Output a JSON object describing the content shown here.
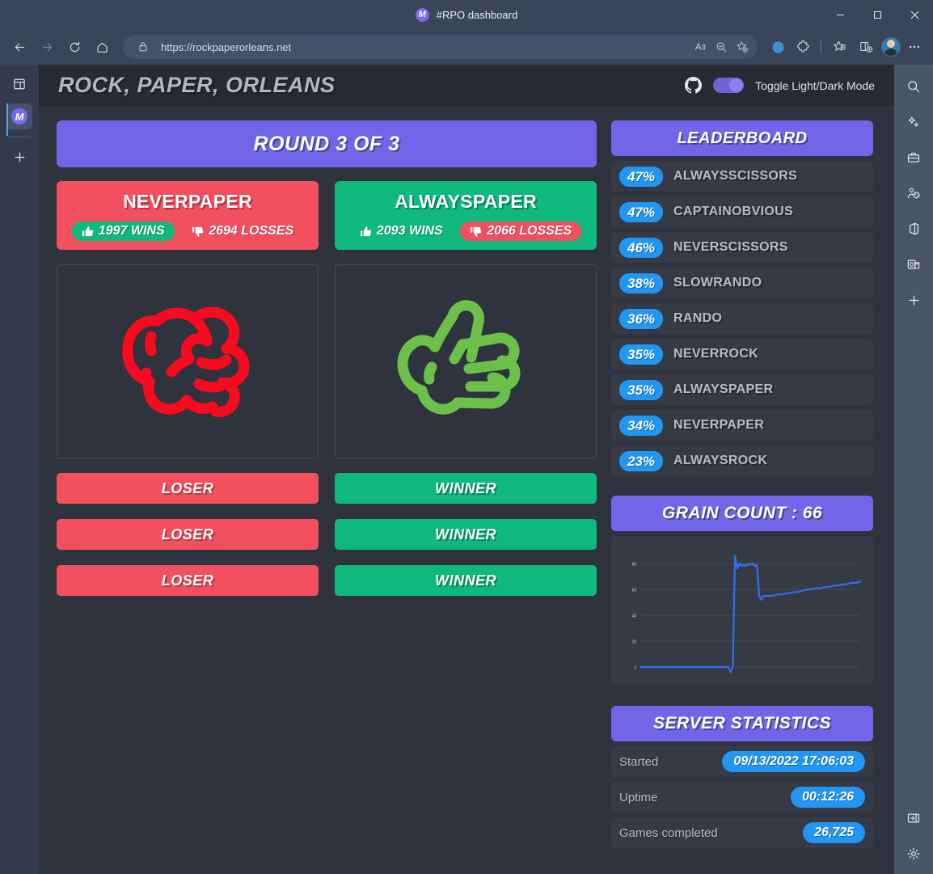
{
  "browser": {
    "tab_title": "#RPO dashboard",
    "tab_favicon": "rpo-logo-icon",
    "url": "https://rockpaperorleans.net",
    "window_controls": [
      "minimize-button",
      "maximize-button",
      "close-button"
    ],
    "nav_icons": [
      "back-icon",
      "forward-icon",
      "refresh-icon",
      "home-icon"
    ],
    "url_icons": [
      "site-permissions-icon",
      "read-aloud-icon",
      "zoom-out-icon",
      "add-favorite-icon"
    ],
    "toolbar_icons": [
      "browser-essentials-icon",
      "extensions-icon",
      "favorites-icon",
      "split-screen-icon",
      "profile-avatar",
      "settings-more-icon"
    ],
    "left_rail_icons": [
      "tab-actions-icon",
      "rpo-tab-icon",
      "new-tab-icon"
    ],
    "right_rail_icons": [
      "search-icon",
      "copilot-icon",
      "tools-icon",
      "games-icon",
      "office-icon",
      "outlook-icon",
      "add-sidebar-icon",
      "expand-sidebar-icon",
      "sidebar-settings-icon"
    ]
  },
  "site": {
    "title": "ROCK, PAPER, ORLEANS",
    "github_label": "github-icon",
    "toggle_label": "Toggle Light/Dark Mode",
    "toggle_on": true,
    "colors": {
      "purple": "#7067e8",
      "red": "#f2505f",
      "green": "#0fb87c",
      "blue": "#2196f3",
      "page_bg": "#2f333d",
      "card_bg": "#353a45"
    }
  },
  "round": {
    "banner": "ROUND 3 OF 3"
  },
  "players": [
    {
      "name": "NEVERPAPER",
      "color": "red",
      "wins_label": "1997 WINS",
      "wins": 1997,
      "losses_label": "2694 LOSSES",
      "losses": 2694,
      "wins_highlight": "green",
      "losses_highlight": "none",
      "hand": "rock",
      "hand_color": "#fa0a1e",
      "results": [
        "LOSER",
        "LOSER",
        "LOSER"
      ],
      "result_color": "red"
    },
    {
      "name": "ALWAYSPAPER",
      "color": "green",
      "wins_label": "2093 WINS",
      "wins": 2093,
      "losses_label": "2066 LOSSES",
      "losses": 2066,
      "wins_highlight": "none",
      "losses_highlight": "red",
      "hand": "paper",
      "hand_color": "#6cc04a",
      "results": [
        "WINNER",
        "WINNER",
        "WINNER"
      ],
      "result_color": "green"
    }
  ],
  "leaderboard": {
    "title": "LEADERBOARD",
    "rows": [
      {
        "pct": "47%",
        "name": "ALWAYSSCISSORS"
      },
      {
        "pct": "47%",
        "name": "CAPTAINOBVIOUS"
      },
      {
        "pct": "46%",
        "name": "NEVERSCISSORS"
      },
      {
        "pct": "38%",
        "name": "SLOWRANDO"
      },
      {
        "pct": "36%",
        "name": "RANDO"
      },
      {
        "pct": "35%",
        "name": "NEVERROCK"
      },
      {
        "pct": "35%",
        "name": "ALWAYSPAPER"
      },
      {
        "pct": "34%",
        "name": "NEVERPAPER"
      },
      {
        "pct": "23%",
        "name": "ALWAYSROCK"
      }
    ]
  },
  "grain": {
    "title": "GRAIN COUNT : 66",
    "count": 66
  },
  "chart_data": {
    "type": "line",
    "title": "GRAIN COUNT : 66",
    "xlabel": "",
    "ylabel": "",
    "ylim": [
      0,
      90
    ],
    "yticks": [
      0,
      20,
      40,
      60,
      80
    ],
    "grid": true,
    "legend": false,
    "line_color": "#2f6ef0",
    "x": [
      0,
      2,
      4,
      6,
      8,
      10,
      12,
      14,
      16,
      18,
      20,
      22,
      24,
      26,
      28,
      30,
      32,
      34,
      36,
      38,
      40,
      41,
      42,
      43,
      44,
      45,
      46,
      47,
      48,
      49,
      50,
      51,
      52,
      53,
      54,
      55,
      56,
      58,
      60,
      62,
      64,
      66,
      68,
      70,
      72,
      74,
      76,
      78,
      80,
      82,
      84,
      86,
      88,
      90,
      92,
      94,
      96,
      98,
      100
    ],
    "y": [
      0,
      0,
      0,
      0,
      0,
      0,
      0,
      0,
      0,
      0,
      0,
      0,
      0,
      0,
      0,
      0,
      0,
      0,
      0,
      0,
      0,
      -4,
      0,
      86,
      76,
      80,
      78,
      79,
      78,
      80,
      79,
      80,
      78,
      79,
      55,
      52,
      55,
      55,
      55,
      56,
      56,
      57,
      57,
      58,
      58,
      59,
      60,
      60,
      61,
      61,
      62,
      62,
      63,
      63,
      64,
      64,
      65,
      65,
      66
    ]
  },
  "server_stats": {
    "title": "SERVER STATISTICS",
    "rows": [
      {
        "label": "Started",
        "value": "09/13/2022 17:06:03"
      },
      {
        "label": "Uptime",
        "value": "00:12:26"
      },
      {
        "label": "Games completed",
        "value": "26,725"
      }
    ]
  }
}
